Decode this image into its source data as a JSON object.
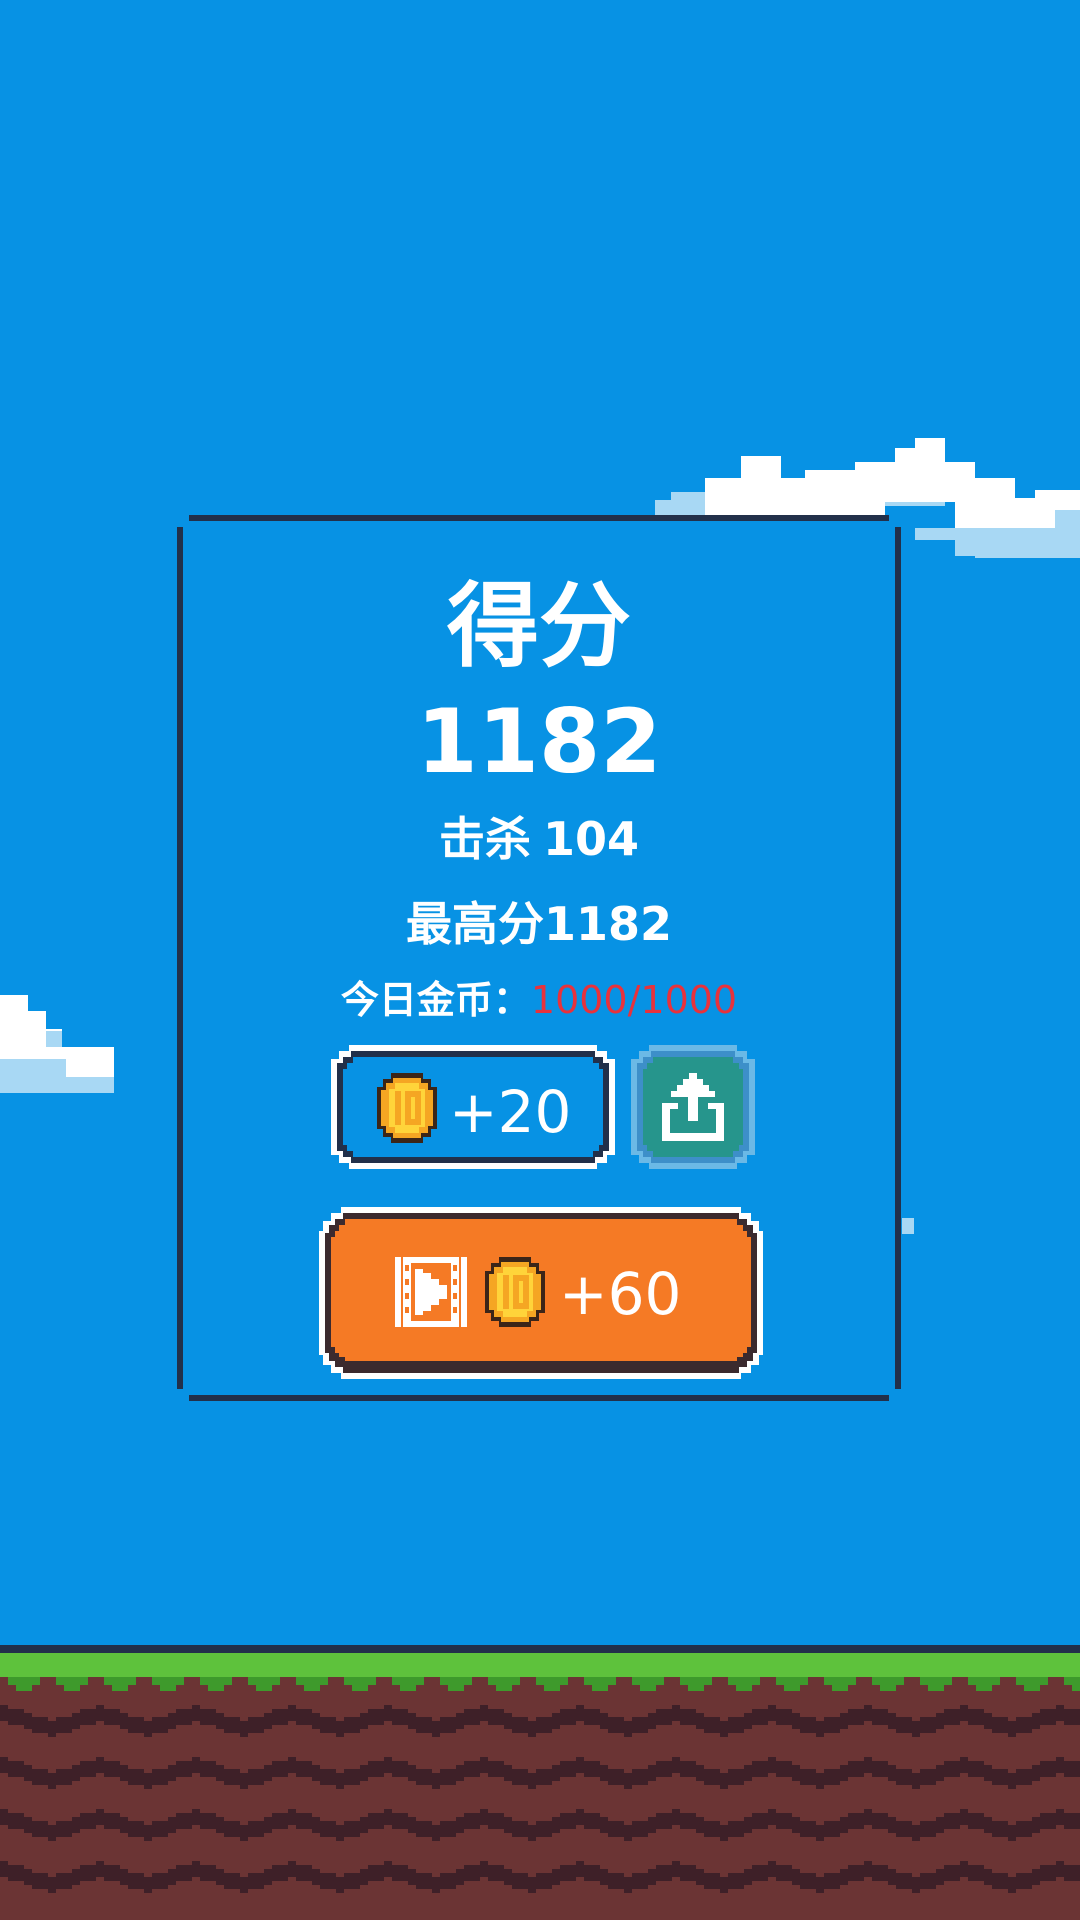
{
  "result_panel": {
    "title": "得分",
    "score": "1182",
    "kills_label": "击杀",
    "kills_value": "104",
    "best_score_label": "最高分",
    "best_score_value": "1182",
    "daily_coins_label": "今日金币：",
    "daily_coins_value": "1000/1000"
  },
  "buttons": {
    "collect_coins": "+20",
    "video_coins": "+60",
    "share_icon": "share-icon",
    "video_icon": "video-play-icon",
    "coin_icon": "coin-icon"
  },
  "colors": {
    "sky": "#0792e4",
    "panel_border": "#22304a",
    "coin_count_red": "#e8323c",
    "share_button": "#26958c",
    "video_button": "#f57a25",
    "grass": "#5ec23c",
    "dirt": "#6b3434",
    "dirt_dark": "#3e2028"
  }
}
